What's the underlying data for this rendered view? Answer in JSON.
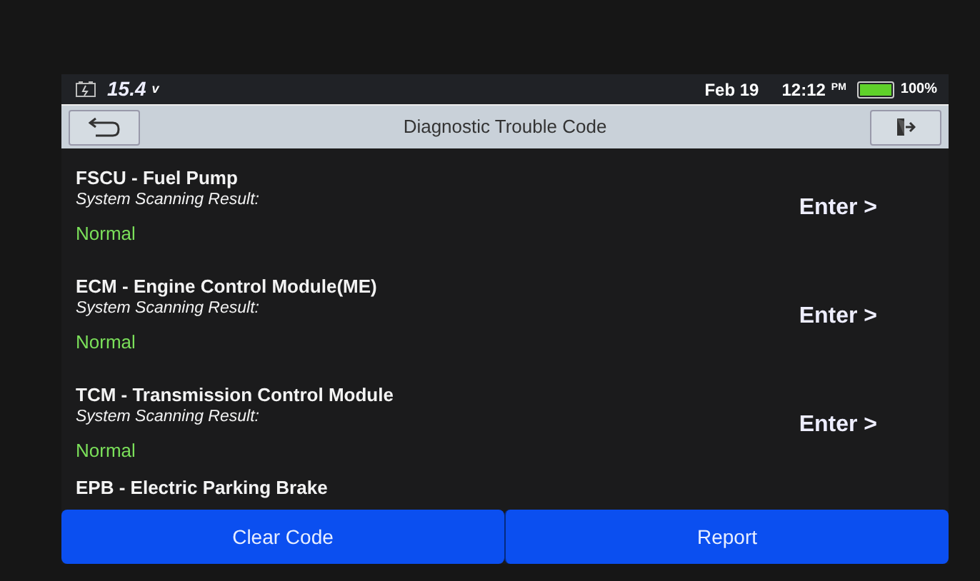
{
  "status_bar": {
    "voltage": "15.4",
    "voltage_unit": "v",
    "date": "Feb 19",
    "time": "12:12",
    "meridiem": "PM",
    "battery": {
      "level": 1.0,
      "reading": "100%"
    }
  },
  "title_bar": {
    "title": "Diagnostic Trouble Code"
  },
  "systems": [
    {
      "name": "FSCU - Fuel Pump",
      "label": "System Scanning Result:",
      "result": "Normal",
      "action": "Enter >"
    },
    {
      "name": "ECM - Engine Control Module(ME)",
      "label": "System Scanning Result:",
      "result": "Normal",
      "action": "Enter >"
    },
    {
      "name": "TCM - Transmission Control Module",
      "label": "System Scanning Result:",
      "result": "Normal",
      "action": "Enter >"
    },
    {
      "name": "EPB - Electric Parking Brake"
    }
  ],
  "buttons": [
    "Clear Code",
    "Report"
  ]
}
